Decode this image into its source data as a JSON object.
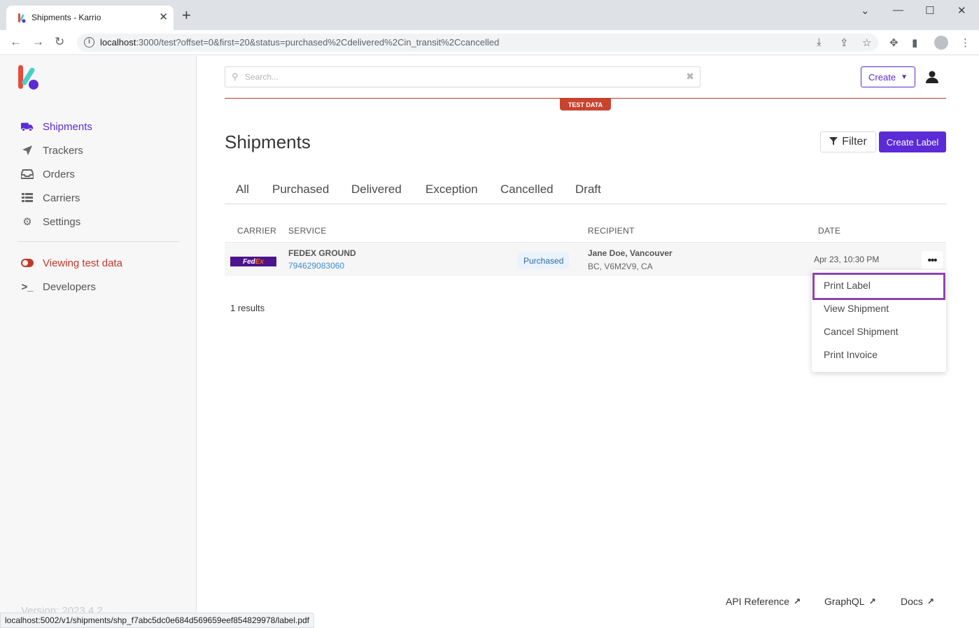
{
  "browser": {
    "tab_title": "Shipments - Karrio",
    "url_host": "localhost",
    "url_rest": ":3000/test?offset=0&first=20&status=purchased%2Cdelivered%2Cin_transit%2Ccancelled",
    "status_url": "localhost:5002/v1/shipments/shp_f7abc5dc0e684d569659eef854829978/label.pdf"
  },
  "sidebar": {
    "items": [
      {
        "label": "Shipments",
        "icon": "truck-icon"
      },
      {
        "label": "Trackers",
        "icon": "location-arrow-icon"
      },
      {
        "label": "Orders",
        "icon": "inbox-icon"
      },
      {
        "label": "Carriers",
        "icon": "list-icon"
      },
      {
        "label": "Settings",
        "icon": "gear-icon"
      }
    ],
    "test_toggle": "Viewing test data",
    "developers": "Developers",
    "version": "Version: 2023.4.2"
  },
  "header": {
    "search_placeholder": "Search...",
    "create_label": "Create",
    "test_badge": "TEST DATA"
  },
  "page": {
    "title": "Shipments",
    "filter_label": "Filter",
    "create_label_button": "Create Label",
    "tabs": [
      "All",
      "Purchased",
      "Delivered",
      "Exception",
      "Cancelled",
      "Draft"
    ]
  },
  "table": {
    "columns": [
      "CARRIER",
      "SERVICE",
      "RECIPIENT",
      "DATE"
    ],
    "rows": [
      {
        "carrier_logo_fed": "Fed",
        "carrier_logo_ex": "Ex",
        "service": "FEDEX GROUND",
        "tracking": "794629083060",
        "status": "Purchased",
        "recipient_name": "Jane Doe, Vancouver",
        "recipient_addr": "BC, V6M2V9, CA",
        "date": "Apr 23, 10:30 PM"
      }
    ],
    "results": "1 results"
  },
  "dropdown": {
    "items": [
      "Print Label",
      "View Shipment",
      "Cancel Shipment",
      "Print Invoice"
    ]
  },
  "footer": {
    "links": [
      "API Reference",
      "GraphQL",
      "Docs"
    ]
  },
  "colors": {
    "accent": "#5b2bd6",
    "test_red": "#c0392b",
    "highlight": "#8e44ad"
  }
}
